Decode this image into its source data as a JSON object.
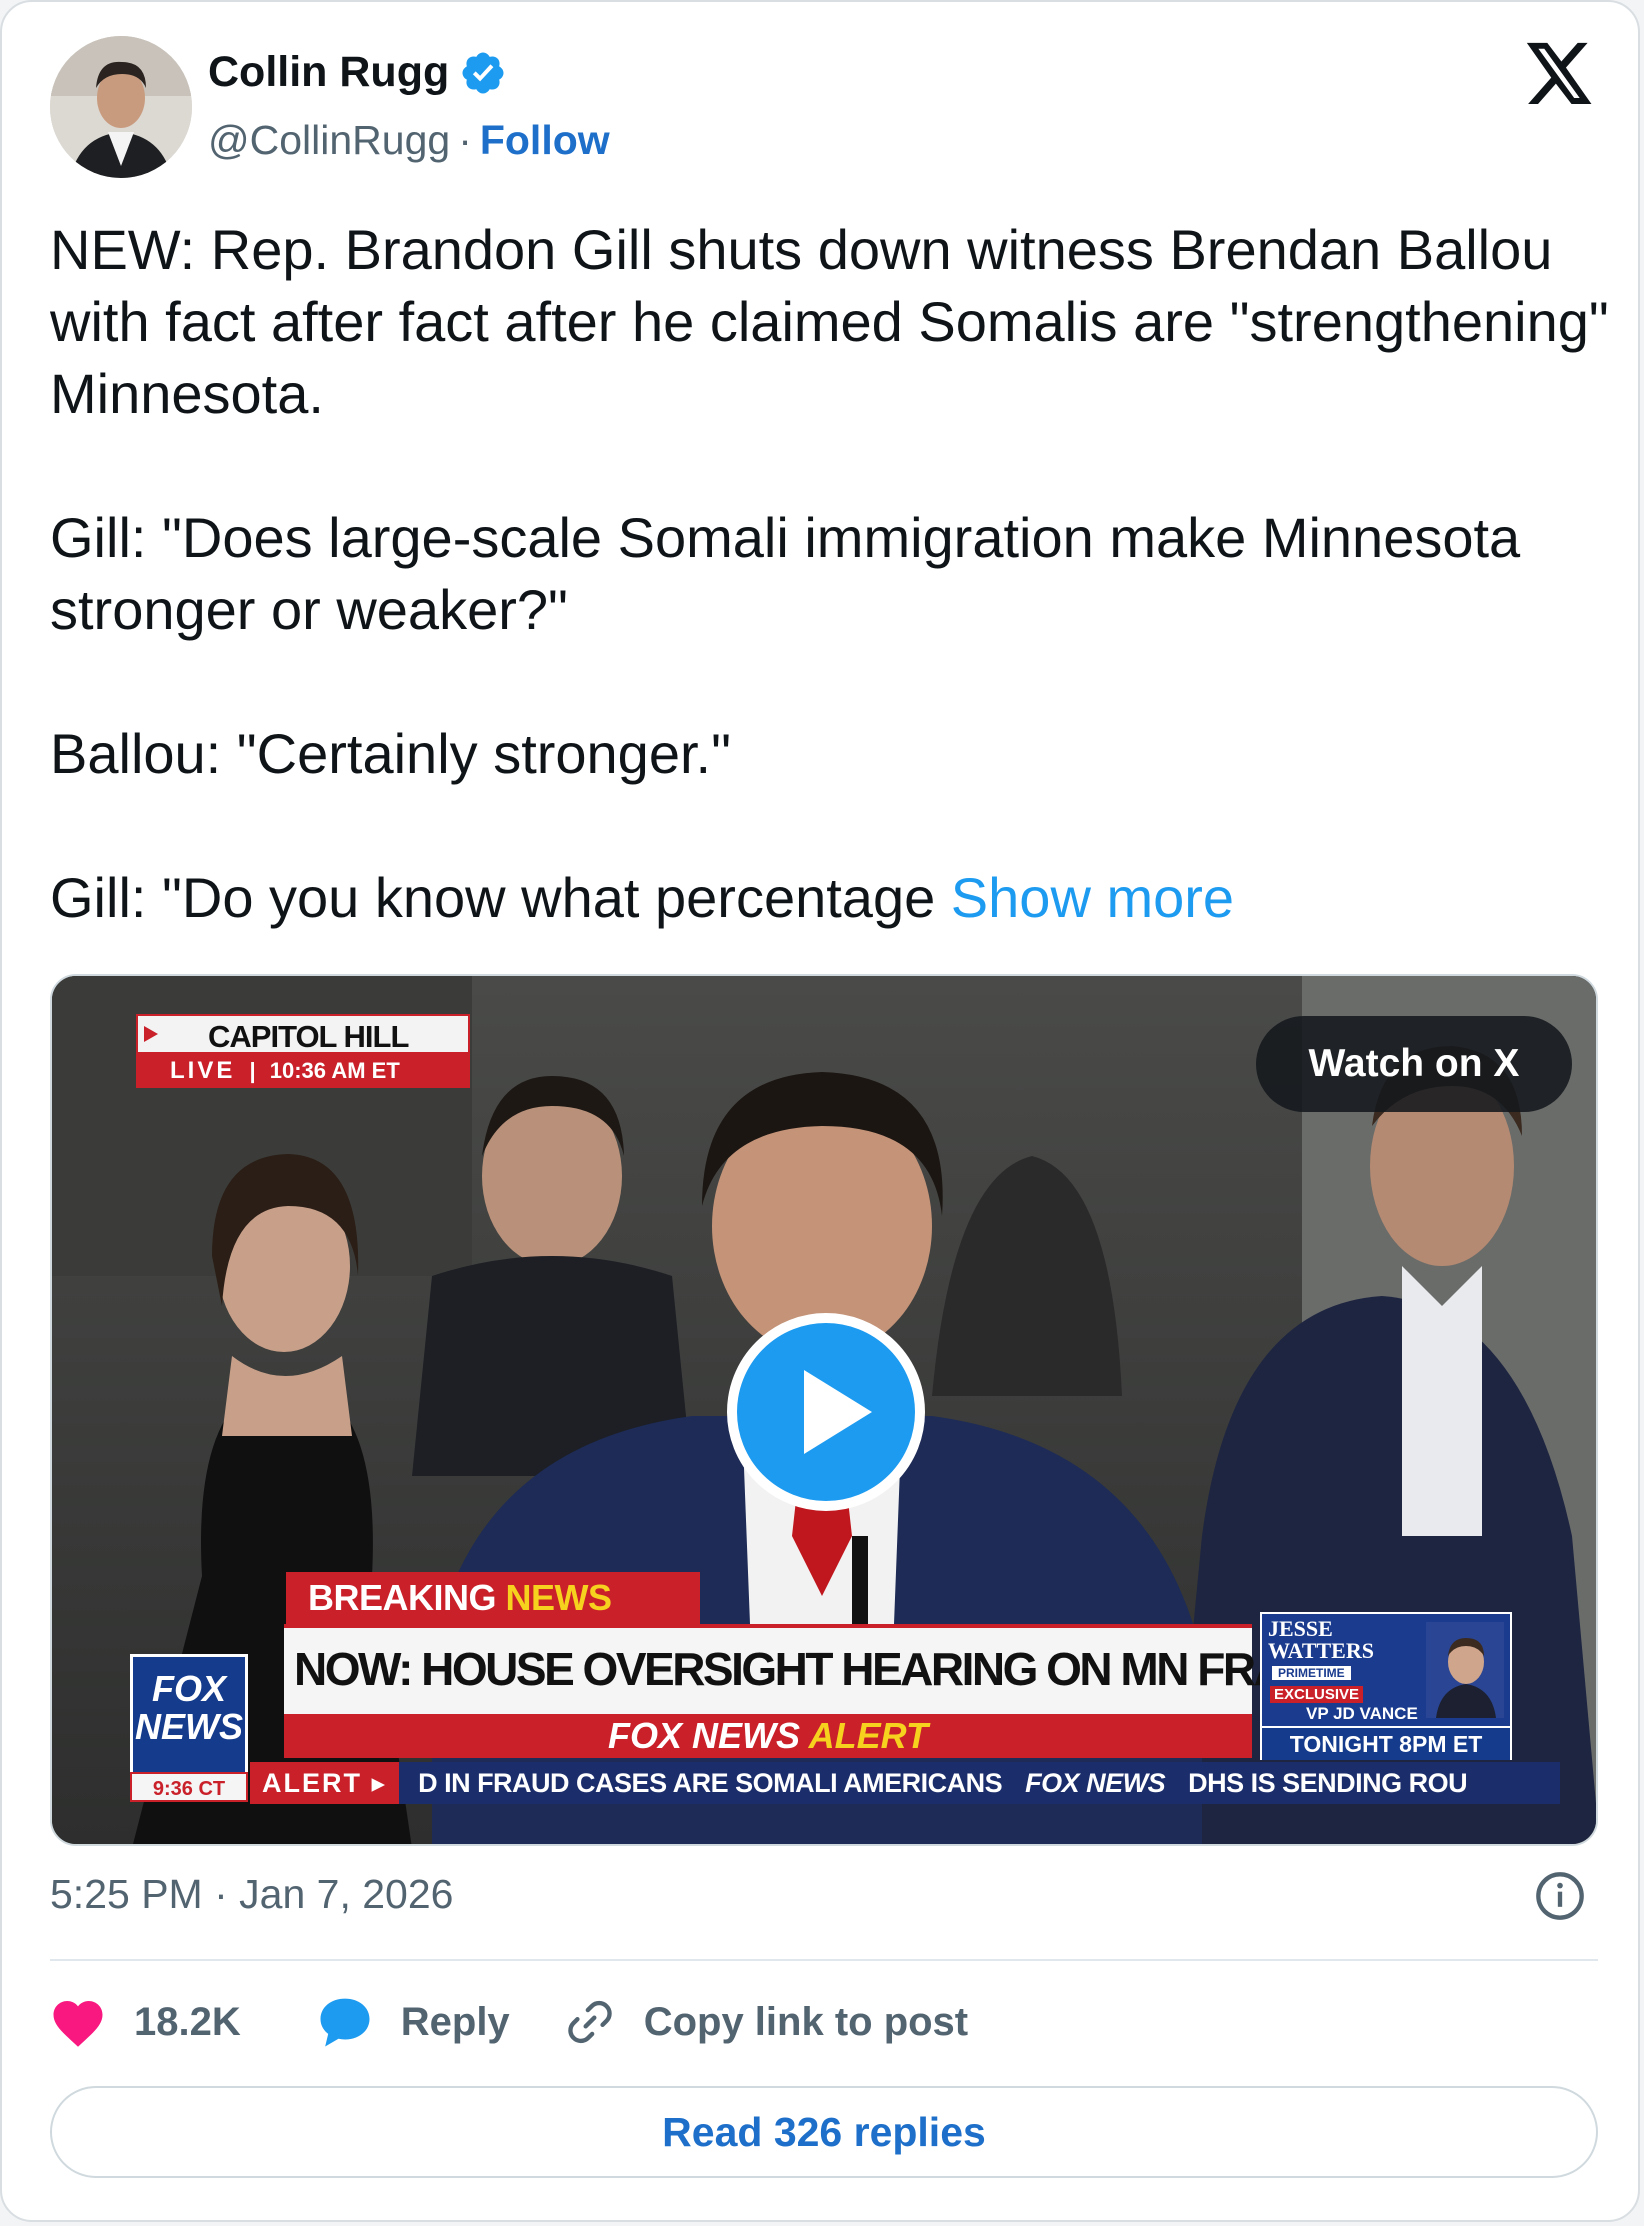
{
  "author": {
    "name": "Collin Rugg",
    "handle": "@CollinRugg",
    "separator": "·",
    "follow_label": "Follow",
    "verified_icon": "verified-badge-icon",
    "avatar_icon": "avatar"
  },
  "platform_logo": "x-logo-icon",
  "tweet": {
    "paragraphs": [
      "NEW: Rep. Brandon Gill shuts down witness Brendan Ballou with fact after fact after he claimed Somalis are \"strengthening\" Minnesota.",
      "Gill: \"Does large-scale Somali immigration make Minnesota stronger or weaker?\"",
      "Ballou: \"Certainly stronger.\"",
      "Gill: \"Do you know what percentage"
    ],
    "show_more": "Show more"
  },
  "media": {
    "watch_label": "Watch on X",
    "play_icon": "play-icon",
    "chyron": {
      "location": "CAPITOL HILL",
      "live": "LIVE",
      "live_time": "10:36 AM ET",
      "breaking": "BREAKING",
      "news": "NEWS",
      "headline": "NOW: HOUSE OVERSIGHT HEARING ON MN FRAUD PROBE",
      "alert_brand": "FOX NEWS",
      "alert_word": "ALERT",
      "logo_line1": "FOX",
      "logo_line2": "NEWS",
      "logo_time": "9:36 CT",
      "ticker_alert": "ALERT ▸",
      "ticker_text": "D IN FRAUD CASES ARE SOMALI AMERICANS",
      "ticker_brand": "FOX NEWS",
      "ticker_text2": "DHS IS SENDING ROU",
      "promo_name_1": "JESSE",
      "promo_name_2": "WATTERS",
      "promo_primetime": "PRIMETIME",
      "promo_exclusive": "EXCLUSIVE",
      "promo_guest": "VP JD VANCE",
      "promo_time": "TONIGHT 8PM ET"
    }
  },
  "meta": {
    "time": "5:25 PM",
    "separator": "·",
    "date": "Jan 7, 2026",
    "info_icon": "info-icon"
  },
  "actions": {
    "like_count": "18.2K",
    "reply_label": "Reply",
    "copy_label": "Copy link to post"
  },
  "read_replies": "Read 326 replies",
  "colors": {
    "link": "#1d9bf0",
    "accent": "#1d6fc9",
    "like": "#f91880",
    "reply": "#1d9bf0",
    "fox_red": "#c9202a",
    "fox_blue": "#143b8c"
  }
}
